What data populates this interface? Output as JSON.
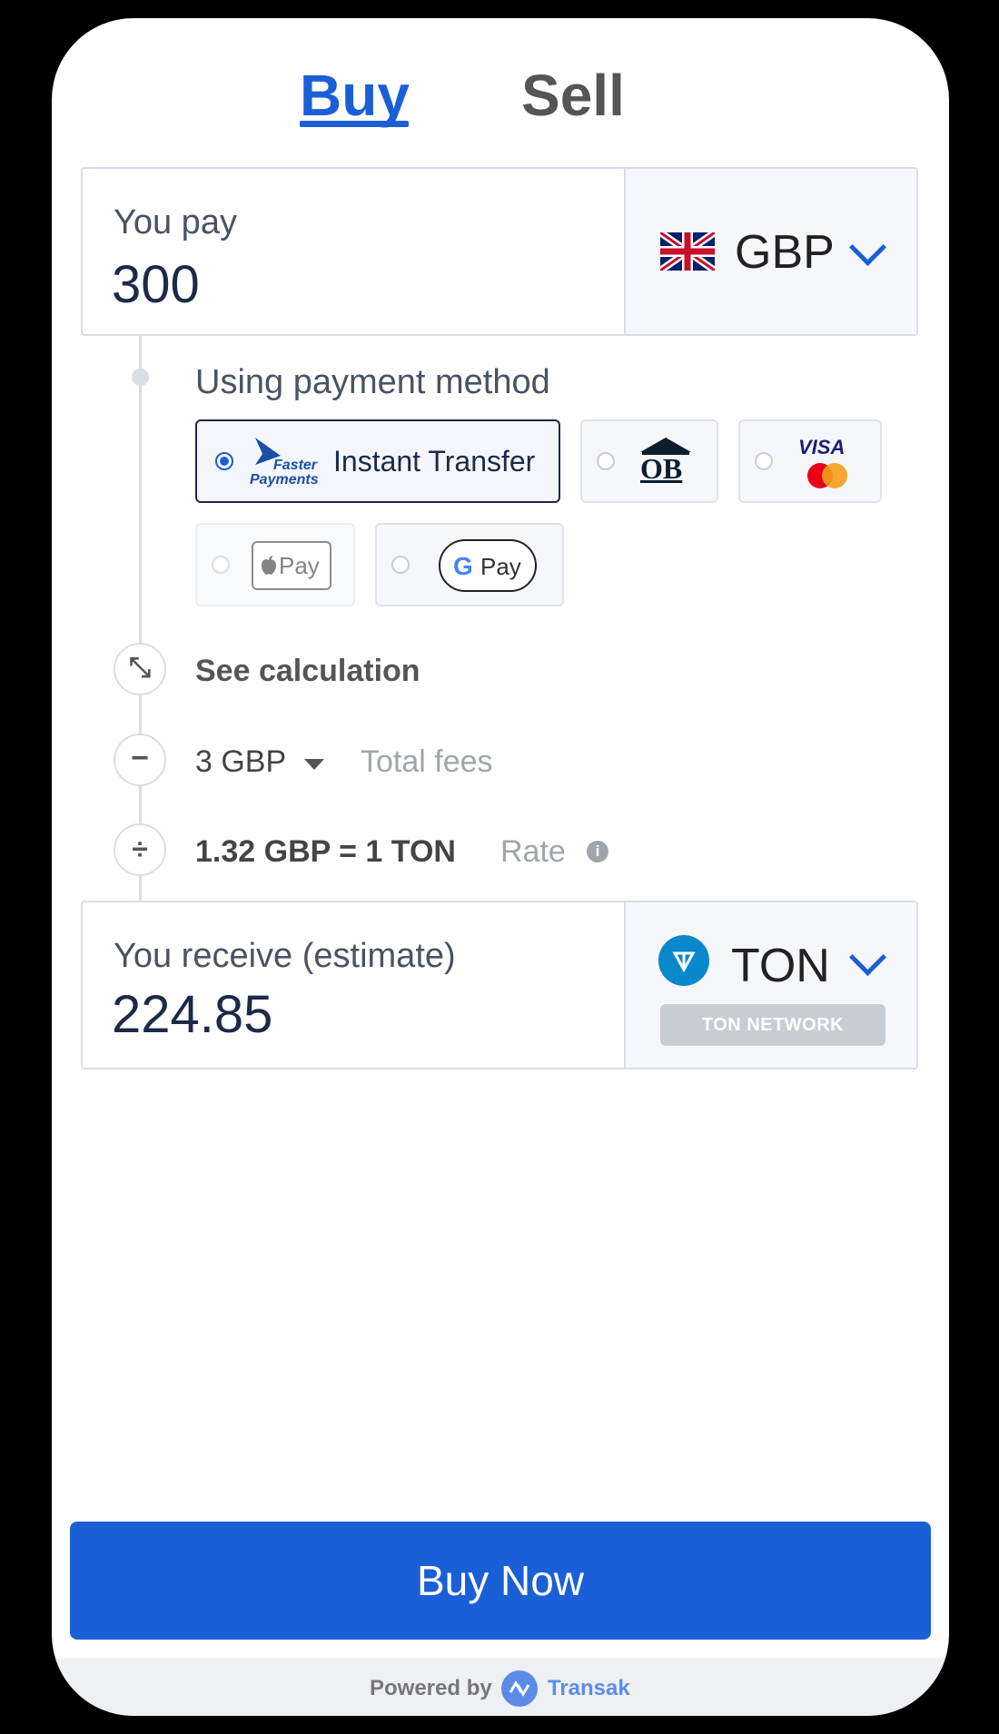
{
  "tabs": {
    "buy": "Buy",
    "sell": "Sell"
  },
  "pay": {
    "label": "You pay",
    "amount": "300",
    "currency": "GBP",
    "currency_icon": "uk-flag-icon"
  },
  "payment_methods": {
    "title": "Using payment method",
    "faster_payments_logo_line1": "Faster",
    "faster_payments_logo_line2": "Payments",
    "instant_transfer": "Instant Transfer",
    "open_banking": "OB",
    "visa": "VISA",
    "apple_pay": "Pay",
    "google_pay": "Pay"
  },
  "calculation": {
    "see_calculation": "See calculation",
    "fee_amount": "3 GBP",
    "fee_label": "Total fees",
    "rate_value": "1.32 GBP = 1 TON",
    "rate_label": "Rate"
  },
  "receive": {
    "label": "You receive (estimate)",
    "amount": "224.85",
    "currency": "TON",
    "network": "TON NETWORK"
  },
  "buy_button": "Buy Now",
  "footer": {
    "powered_by": "Powered by",
    "brand": "Transak"
  },
  "colors": {
    "primary": "#1a5fd6",
    "text_dark": "#1c2a4a",
    "muted": "#9aa0a8"
  }
}
